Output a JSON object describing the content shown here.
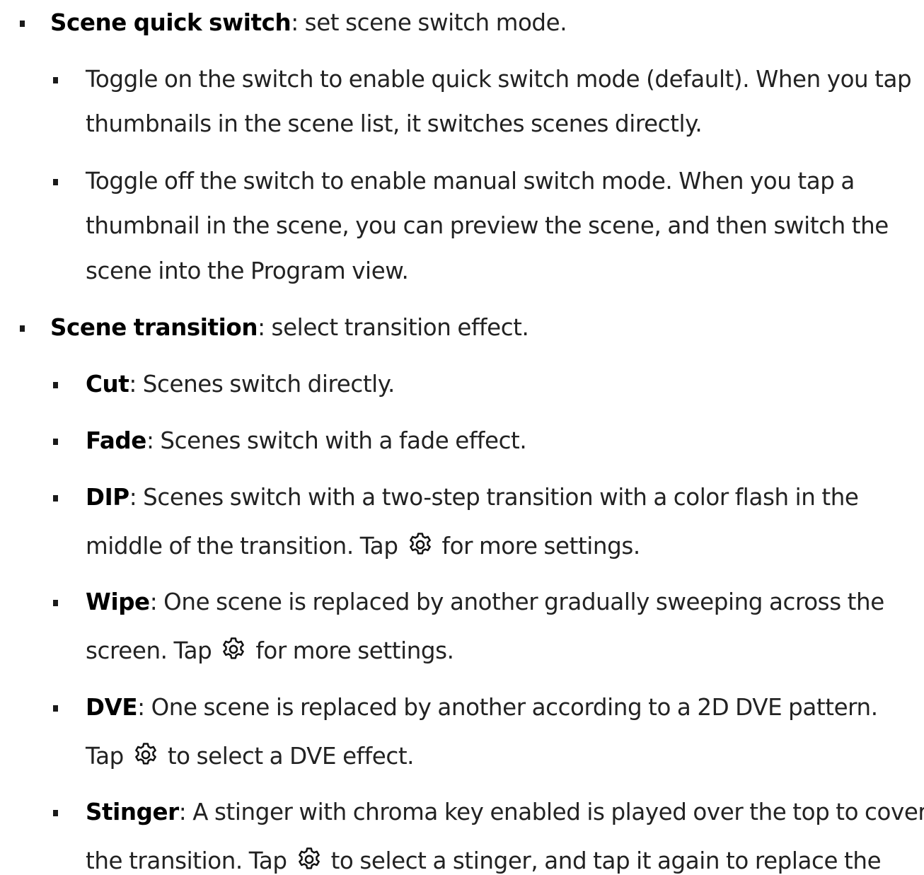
{
  "items": {
    "quick_switch": {
      "term": "Scene quick switch",
      "text": ": set scene switch mode."
    },
    "quick_on": {
      "line1": "Toggle on the switch to enable quick switch mode (default). When you tap",
      "line2": "thumbnails in the scene list, it switches scenes directly."
    },
    "quick_off": {
      "line1": "Toggle off the switch to enable manual switch mode. When you tap a",
      "line2": "thumbnail in the scene, you can preview the scene, and then switch the",
      "line3": "scene into the Program view."
    },
    "transition": {
      "term": "Scene transition",
      "text": ": select transition effect."
    },
    "cut": {
      "term": "Cut",
      "text": ": Scenes switch directly."
    },
    "fade": {
      "term": "Fade",
      "text": ": Scenes switch with a fade effect."
    },
    "dip": {
      "term": "DIP",
      "line1": ": Scenes switch with a two-step transition with a color flash in the",
      "line2_before": "middle of the transition. Tap",
      "line2_after": "for more settings."
    },
    "wipe": {
      "term": "Wipe",
      "line1": ": One scene is replaced by another gradually sweeping across the",
      "line2_before": "screen. Tap",
      "line2_after": "for more settings."
    },
    "dve": {
      "term": "DVE",
      "line1": ": One scene is replaced by another according to a 2D DVE pattern.",
      "line2_before": "Tap",
      "line2_after": "to select a DVE effect."
    },
    "stinger": {
      "term": "Stinger",
      "line1": ": A stinger with chroma key enabled is played over the top to cover",
      "line2_before": "the transition. Tap",
      "line2_after": "to select a stinger, and tap it again to replace the"
    }
  },
  "icons": {
    "settings": "gear-icon"
  },
  "colors": {
    "text": "#222222",
    "term": "#000000"
  }
}
